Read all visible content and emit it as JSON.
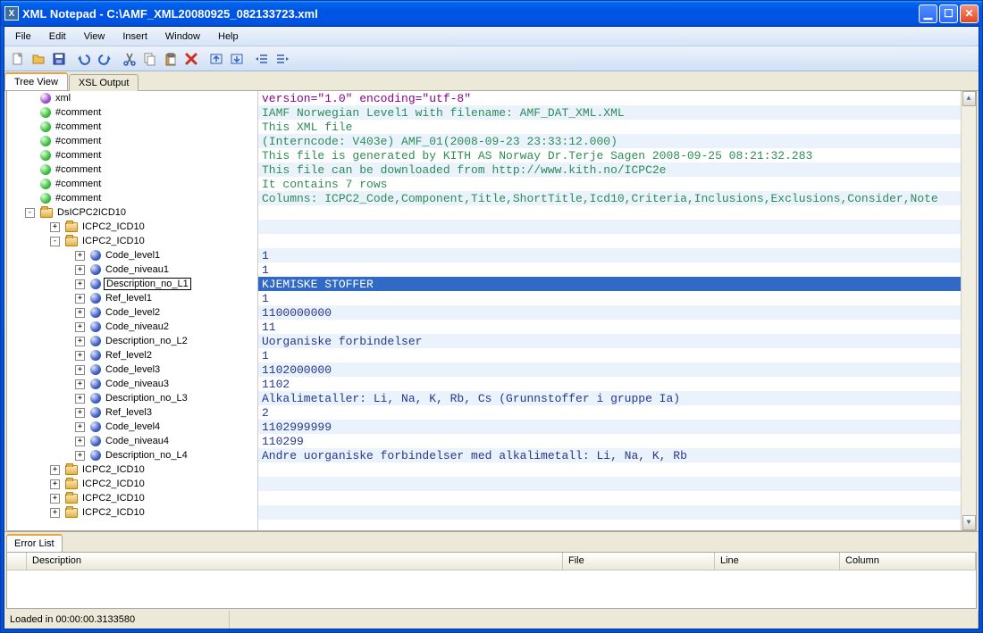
{
  "window": {
    "title": "XML Notepad - C:\\AMF_XML20080925_082133723.xml"
  },
  "menu": [
    "File",
    "Edit",
    "View",
    "Insert",
    "Window",
    "Help"
  ],
  "toolbar_icons": [
    "new",
    "open",
    "save",
    "undo",
    "redo",
    "cut",
    "copy",
    "paste",
    "delete",
    "outdent",
    "indent",
    "bullets-left",
    "bullets-right"
  ],
  "tabs": {
    "treeview": "Tree View",
    "xsl": "XSL Output"
  },
  "tree": [
    {
      "indent": 0,
      "exp": "",
      "icon": "purple",
      "label": "xml"
    },
    {
      "indent": 0,
      "exp": "",
      "icon": "green",
      "label": "#comment"
    },
    {
      "indent": 0,
      "exp": "",
      "icon": "green",
      "label": "#comment"
    },
    {
      "indent": 0,
      "exp": "",
      "icon": "green",
      "label": "#comment"
    },
    {
      "indent": 0,
      "exp": "",
      "icon": "green",
      "label": "#comment"
    },
    {
      "indent": 0,
      "exp": "",
      "icon": "green",
      "label": "#comment"
    },
    {
      "indent": 0,
      "exp": "",
      "icon": "green",
      "label": "#comment"
    },
    {
      "indent": 0,
      "exp": "",
      "icon": "green",
      "label": "#comment"
    },
    {
      "indent": 0,
      "exp": "-",
      "icon": "folder",
      "label": "DsICPC2ICD10"
    },
    {
      "indent": 1,
      "exp": "+",
      "icon": "folder",
      "label": "ICPC2_ICD10"
    },
    {
      "indent": 1,
      "exp": "-",
      "icon": "folder",
      "label": "ICPC2_ICD10"
    },
    {
      "indent": 2,
      "exp": "+",
      "icon": "blue",
      "label": "Code_level1"
    },
    {
      "indent": 2,
      "exp": "+",
      "icon": "blue",
      "label": "Code_niveau1"
    },
    {
      "indent": 2,
      "exp": "+",
      "icon": "blue",
      "label": "Description_no_L1",
      "selected": true
    },
    {
      "indent": 2,
      "exp": "+",
      "icon": "blue",
      "label": "Ref_level1"
    },
    {
      "indent": 2,
      "exp": "+",
      "icon": "blue",
      "label": "Code_level2"
    },
    {
      "indent": 2,
      "exp": "+",
      "icon": "blue",
      "label": "Code_niveau2"
    },
    {
      "indent": 2,
      "exp": "+",
      "icon": "blue",
      "label": "Description_no_L2"
    },
    {
      "indent": 2,
      "exp": "+",
      "icon": "blue",
      "label": "Ref_level2"
    },
    {
      "indent": 2,
      "exp": "+",
      "icon": "blue",
      "label": "Code_level3"
    },
    {
      "indent": 2,
      "exp": "+",
      "icon": "blue",
      "label": "Code_niveau3"
    },
    {
      "indent": 2,
      "exp": "+",
      "icon": "blue",
      "label": "Description_no_L3"
    },
    {
      "indent": 2,
      "exp": "+",
      "icon": "blue",
      "label": "Ref_level3"
    },
    {
      "indent": 2,
      "exp": "+",
      "icon": "blue",
      "label": "Code_level4"
    },
    {
      "indent": 2,
      "exp": "+",
      "icon": "blue",
      "label": "Code_niveau4"
    },
    {
      "indent": 2,
      "exp": "+",
      "icon": "blue",
      "label": "Description_no_L4"
    },
    {
      "indent": 1,
      "exp": "+",
      "icon": "folder",
      "label": "ICPC2_ICD10"
    },
    {
      "indent": 1,
      "exp": "+",
      "icon": "folder",
      "label": "ICPC2_ICD10"
    },
    {
      "indent": 1,
      "exp": "+",
      "icon": "folder",
      "label": "ICPC2_ICD10"
    },
    {
      "indent": 1,
      "exp": "+",
      "icon": "folder",
      "label": "ICPC2_ICD10"
    }
  ],
  "values": [
    {
      "text": "version=\"1.0\" encoding=\"utf-8\"",
      "cls": "txt-purple"
    },
    {
      "text": "IAMF Norwegian Level1 with filename: AMF_DAT_XML.XML",
      "cls": "txt-green",
      "alt": true
    },
    {
      "text": "This XML file",
      "cls": "txt-green"
    },
    {
      "text": "(Interncode: V403e) AMF_01(2008-09-23 23:33:12.000)",
      "cls": "txt-green",
      "alt": true
    },
    {
      "text": "This file is generated by KITH AS  Norway Dr.Terje Sagen 2008-09-25 08:21:32.283",
      "cls": "txt-green"
    },
    {
      "text": "This file can be downloaded from http://www.kith.no/ICPC2e",
      "cls": "txt-green",
      "alt": true
    },
    {
      "text": "It contains 7 rows",
      "cls": "txt-green"
    },
    {
      "text": "Columns: ICPC2_Code,Component,Title,ShortTitle,Icd10,Criteria,Inclusions,Exclusions,Consider,Note",
      "cls": "txt-green",
      "alt": true
    },
    {
      "text": "",
      "cls": ""
    },
    {
      "text": "",
      "cls": "",
      "alt": true
    },
    {
      "text": "",
      "cls": ""
    },
    {
      "text": "1",
      "cls": "txt-navy",
      "alt": true
    },
    {
      "text": "1",
      "cls": "txt-navy"
    },
    {
      "text": "KJEMISKE STOFFER",
      "cls": "",
      "selected": true
    },
    {
      "text": "1",
      "cls": "txt-navy"
    },
    {
      "text": "1100000000",
      "cls": "txt-navy",
      "alt": true
    },
    {
      "text": "11",
      "cls": "txt-navy"
    },
    {
      "text": "Uorganiske forbindelser",
      "cls": "txt-navy",
      "alt": true
    },
    {
      "text": "1",
      "cls": "txt-navy"
    },
    {
      "text": "1102000000",
      "cls": "txt-navy",
      "alt": true
    },
    {
      "text": "1102",
      "cls": "txt-navy"
    },
    {
      "text": "Alkalimetaller: Li, Na, K, Rb, Cs (Grunnstoffer i gruppe Ia)",
      "cls": "txt-navy",
      "alt": true
    },
    {
      "text": "2",
      "cls": "txt-navy"
    },
    {
      "text": "1102999999",
      "cls": "txt-navy",
      "alt": true
    },
    {
      "text": "110299",
      "cls": "txt-navy"
    },
    {
      "text": "Andre uorganiske forbindelser med alkalimetall: Li, Na, K, Rb",
      "cls": "txt-navy",
      "alt": true
    },
    {
      "text": "",
      "cls": ""
    },
    {
      "text": "",
      "cls": "",
      "alt": true
    },
    {
      "text": "",
      "cls": ""
    },
    {
      "text": "",
      "cls": "",
      "alt": true
    }
  ],
  "error_panel": {
    "tab": "Error List",
    "columns": {
      "description": "Description",
      "file": "File",
      "line": "Line",
      "column": "Column"
    }
  },
  "status": "Loaded in 00:00:00.3133580"
}
